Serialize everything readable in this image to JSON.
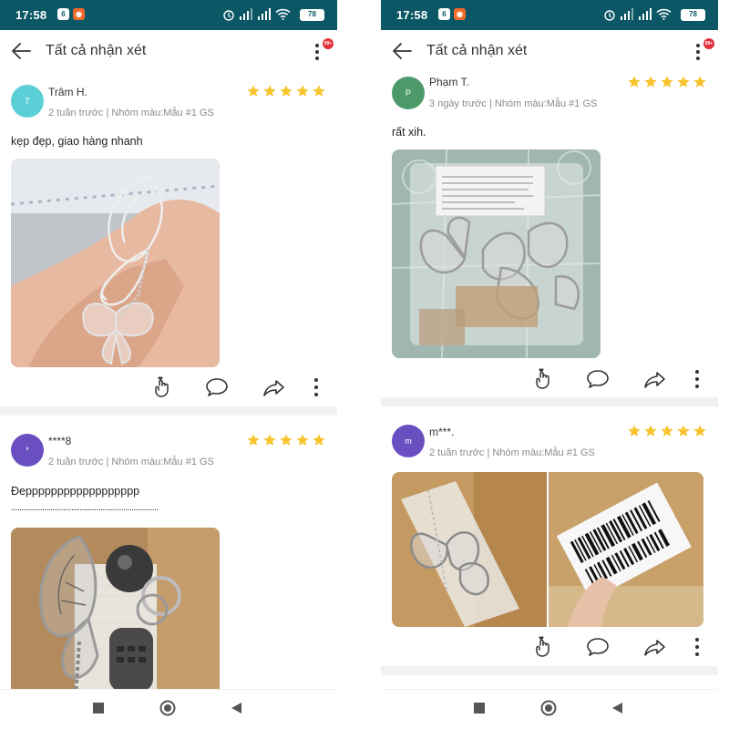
{
  "status_bar": {
    "time": "17:58",
    "notif_badge": "6",
    "battery": "78"
  },
  "app_bar": {
    "title": "Tất cả nhận xét",
    "more_badge": "99+"
  },
  "left_screen": {
    "reviews": [
      {
        "avatar_letter": "T",
        "avatar_color": "#5ccfd6",
        "name": "Trâm H.",
        "meta": "2 tuần trước | Nhóm màu:Mẫu #1 GS",
        "rating": 5,
        "text": "kẹp đẹp, giao hàng nhanh",
        "photo_icon": "butterfly-hairclip-in-hand-photo"
      },
      {
        "avatar_letter": "*",
        "avatar_color": "#6a4fc1",
        "name": "****8",
        "meta": "2 tuần trước | Nhóm màu:Mẫu #1 GS",
        "rating": 5,
        "text": "Đepppppppppppppppppp",
        "text_continuation": ".......................................................................",
        "photo_icon": "butterfly-clip-and-keychains-in-box-photo"
      }
    ]
  },
  "right_screen": {
    "reviews": [
      {
        "avatar_letter": "P",
        "avatar_color": "#4c9a69",
        "name": "Phạm T.",
        "meta": "3 ngày trước | Nhóm màu:Mẫu #1 GS",
        "rating": 5,
        "text": "rất xih.",
        "photo_icon": "clips-in-plastic-bag-photo"
      },
      {
        "avatar_letter": "m",
        "avatar_color": "#6a4fc1",
        "name": "m***.",
        "meta": "2 tuần trước | Nhóm màu:Mẫu #1 GS",
        "rating": 5,
        "photos": [
          "butterfly-clip-in-parcel-photo",
          "shipping-label-barcode-photo"
        ]
      }
    ]
  },
  "colors": {
    "status_bar": "#0b5766",
    "star": "#f7c32e",
    "badge": "#e0303a",
    "divider": "#f1f1f1"
  },
  "icons": [
    "back-arrow-icon",
    "more-vertical-icon",
    "star-icon",
    "finger-heart-icon",
    "comment-icon",
    "share-icon",
    "nav-square-icon",
    "nav-circle-icon",
    "nav-triangle-icon"
  ]
}
